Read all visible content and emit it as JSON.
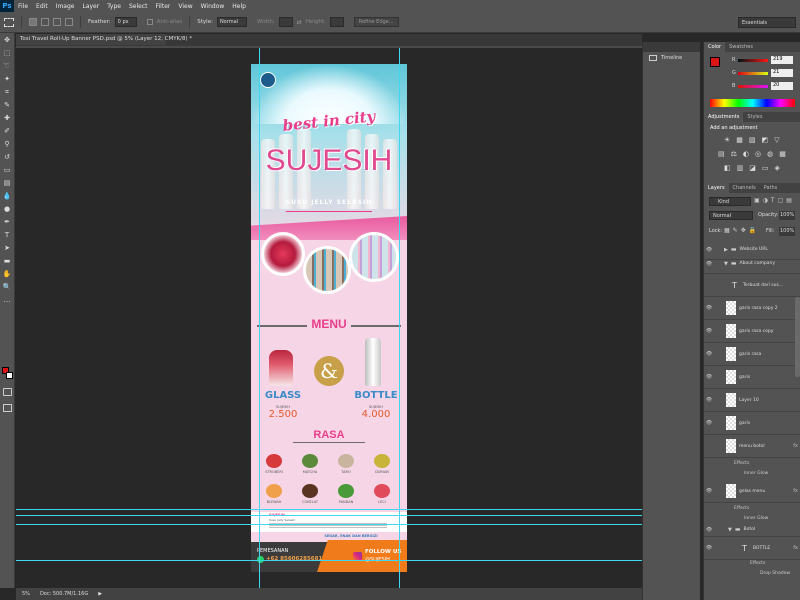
{
  "app": {
    "logo": "Ps"
  },
  "menus": [
    "File",
    "Edit",
    "Image",
    "Layer",
    "Type",
    "Select",
    "Filter",
    "View",
    "Window",
    "Help"
  ],
  "options": {
    "feather_label": "Feather:",
    "feather_value": "0 px",
    "antialias_label": "Anti-alias",
    "style_label": "Style:",
    "style_value": "Normal",
    "width_label": "Width:",
    "height_label": "Height:",
    "refine_label": "Refine Edge...",
    "workspace": "Essentials"
  },
  "document": {
    "tab_title": "Tosi Travel Roll-Up Banner PSD.psd @ 5% (Layer 12, CMYK/8) *",
    "zoom": "5%",
    "doc_info": "Doc: 500.7M/1.16G"
  },
  "banner": {
    "tagline": "best in city",
    "brand": "SUJESIH",
    "subtitle": "SUSU JELLY SELASIH",
    "menu_heading": "MENU",
    "amp": "&",
    "glass_title": "GLASS",
    "glass_sub": "SUJESIH",
    "glass_price": "2.500",
    "bottle_title": "BOTTLE",
    "bottle_sub": "SUJESIH",
    "bottle_price": "4.000",
    "rasa_heading": "RASA",
    "flavors": [
      "STROBERI",
      "MATCHA",
      "TARO",
      "DURIAN",
      "BLEWAH",
      "COKELAT",
      "PANDAN",
      "LECI"
    ],
    "info_title": "SUJESIH",
    "info_sub": "Susu Jelly Selasih",
    "slogan": "SEGAR, ENAK DAN BERGIZI",
    "order_label": "PEMESANAN",
    "phone": "+62 85606285681",
    "follow_label": "FOLLOW US",
    "handle": "@SUJESIH"
  },
  "midpanel": {
    "timeline": "Timeline"
  },
  "color_panel": {
    "tabs": [
      "Color",
      "Swatches"
    ],
    "r_label": "R",
    "r": "219",
    "g_label": "G",
    "g": "21",
    "b_label": "B",
    "b": "20",
    "fg_color": "#db1514"
  },
  "adjustments": {
    "tabs": [
      "Adjustments",
      "Styles"
    ],
    "heading": "Add an adjustment"
  },
  "layers_panel": {
    "tabs": [
      "Layers",
      "Channels",
      "Paths"
    ],
    "kind": "Kind",
    "blend": "Normal",
    "opacity_label": "Opacity:",
    "opacity": "100%",
    "lock_label": "Lock:",
    "fill_label": "Fill:",
    "fill": "100%",
    "layers": [
      {
        "name": "Website URL",
        "type": "group"
      },
      {
        "name": "About company",
        "type": "group"
      },
      {
        "name": "Terbuat dari sus...",
        "type": "text"
      },
      {
        "name": "garis rasa copy 2",
        "type": "layer"
      },
      {
        "name": "garis rasa copy",
        "type": "layer"
      },
      {
        "name": "garis rasa",
        "type": "layer"
      },
      {
        "name": "garis",
        "type": "layer"
      },
      {
        "name": "Layer 10",
        "type": "layer"
      },
      {
        "name": "garis",
        "type": "layer"
      },
      {
        "name": "menu botol",
        "type": "layer",
        "fx": "fx"
      },
      {
        "name": "gelas menu",
        "type": "layer",
        "fx": "fx"
      },
      {
        "name": "Botol",
        "type": "group"
      },
      {
        "name": "BOTTLE",
        "type": "text",
        "fx": "fx"
      }
    ],
    "effects_label": "Effects",
    "inner_glow": "Inner Glow",
    "drop_shadow": "Drop Shadow"
  }
}
